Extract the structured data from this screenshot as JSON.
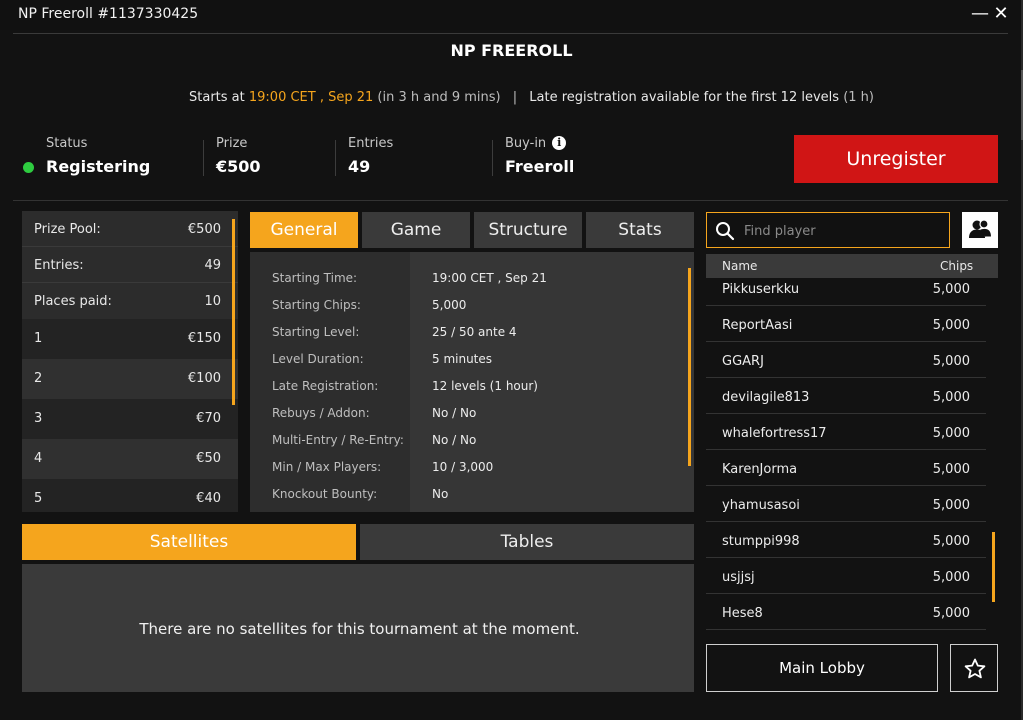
{
  "window": {
    "title": "NP Freeroll #1137330425",
    "minimize_glyph": "—",
    "close_glyph": "✕"
  },
  "tournament": {
    "name": "NP FREEROLL",
    "starts_prefix": "Starts at",
    "start_time": "19:00 CET , Sep 21",
    "countdown": "(in 3 h and 9 mins)",
    "separator": "|",
    "late_reg_text": "Late registration available for the first 12 levels",
    "late_reg_duration": "(1 h)"
  },
  "info": {
    "status_label": "Status",
    "status_value": "Registering",
    "status_color": "#2ecc40",
    "prize_label": "Prize",
    "prize_value": "€500",
    "entries_label": "Entries",
    "entries_value": "49",
    "buyin_label": "Buy-in",
    "buyin_value": "Freeroll",
    "info_icon": "info-icon",
    "unregister_label": "Unregister",
    "unregister_color": "#d01515"
  },
  "prize_summary": [
    {
      "label": "Prize Pool:",
      "value": "€500"
    },
    {
      "label": "Entries:",
      "value": "49"
    },
    {
      "label": "Places paid:",
      "value": "10"
    }
  ],
  "payouts": [
    {
      "place": "1",
      "amount": "€150"
    },
    {
      "place": "2",
      "amount": "€100"
    },
    {
      "place": "3",
      "amount": "€70"
    },
    {
      "place": "4",
      "amount": "€50"
    },
    {
      "place": "5",
      "amount": "€40"
    }
  ],
  "tabs": [
    {
      "label": "General",
      "active": true
    },
    {
      "label": "Game",
      "active": false
    },
    {
      "label": "Structure",
      "active": false
    },
    {
      "label": "Stats",
      "active": false
    }
  ],
  "general_details": [
    {
      "key": "Starting Time:",
      "value": "19:00 CET , Sep 21"
    },
    {
      "key": "Starting Chips:",
      "value": "5,000"
    },
    {
      "key": "Starting Level:",
      "value": "25 / 50 ante 4"
    },
    {
      "key": "Level Duration:",
      "value": "5 minutes"
    },
    {
      "key": "Late Registration:",
      "value": "12 levels (1 hour)"
    },
    {
      "key": "Rebuys / Addon:",
      "value": "No / No"
    },
    {
      "key": "Multi-Entry / Re-Entry:",
      "value": "No / No"
    },
    {
      "key": "Min / Max Players:",
      "value": "10 / 3,000"
    },
    {
      "key": "Knockout Bounty:",
      "value": "No"
    }
  ],
  "bottom_tabs": [
    {
      "label": "Satellites",
      "active": true
    },
    {
      "label": "Tables",
      "active": false
    }
  ],
  "satellites_message": "There are no satellites for this tournament at the moment.",
  "players": {
    "search_placeholder": "Find player",
    "search_value": "",
    "col_name": "Name",
    "col_chips": "Chips",
    "rows": [
      {
        "name": "Pikkuserkku",
        "chips": "5,000"
      },
      {
        "name": "ReportAasi",
        "chips": "5,000"
      },
      {
        "name": "GGARJ",
        "chips": "5,000"
      },
      {
        "name": "devilagile813",
        "chips": "5,000"
      },
      {
        "name": "whalefortress17",
        "chips": "5,000"
      },
      {
        "name": "KarenJorma",
        "chips": "5,000"
      },
      {
        "name": "yhamusasoi",
        "chips": "5,000"
      },
      {
        "name": "stumppi998",
        "chips": "5,000"
      },
      {
        "name": "usjjsj",
        "chips": "5,000"
      },
      {
        "name": "Hese8",
        "chips": "5,000"
      }
    ]
  },
  "footer": {
    "main_lobby_label": "Main Lobby",
    "favorite_icon": "star-icon"
  },
  "colors": {
    "accent": "#f5a51d",
    "background": "#121212",
    "panel": "#2c2c2c"
  }
}
